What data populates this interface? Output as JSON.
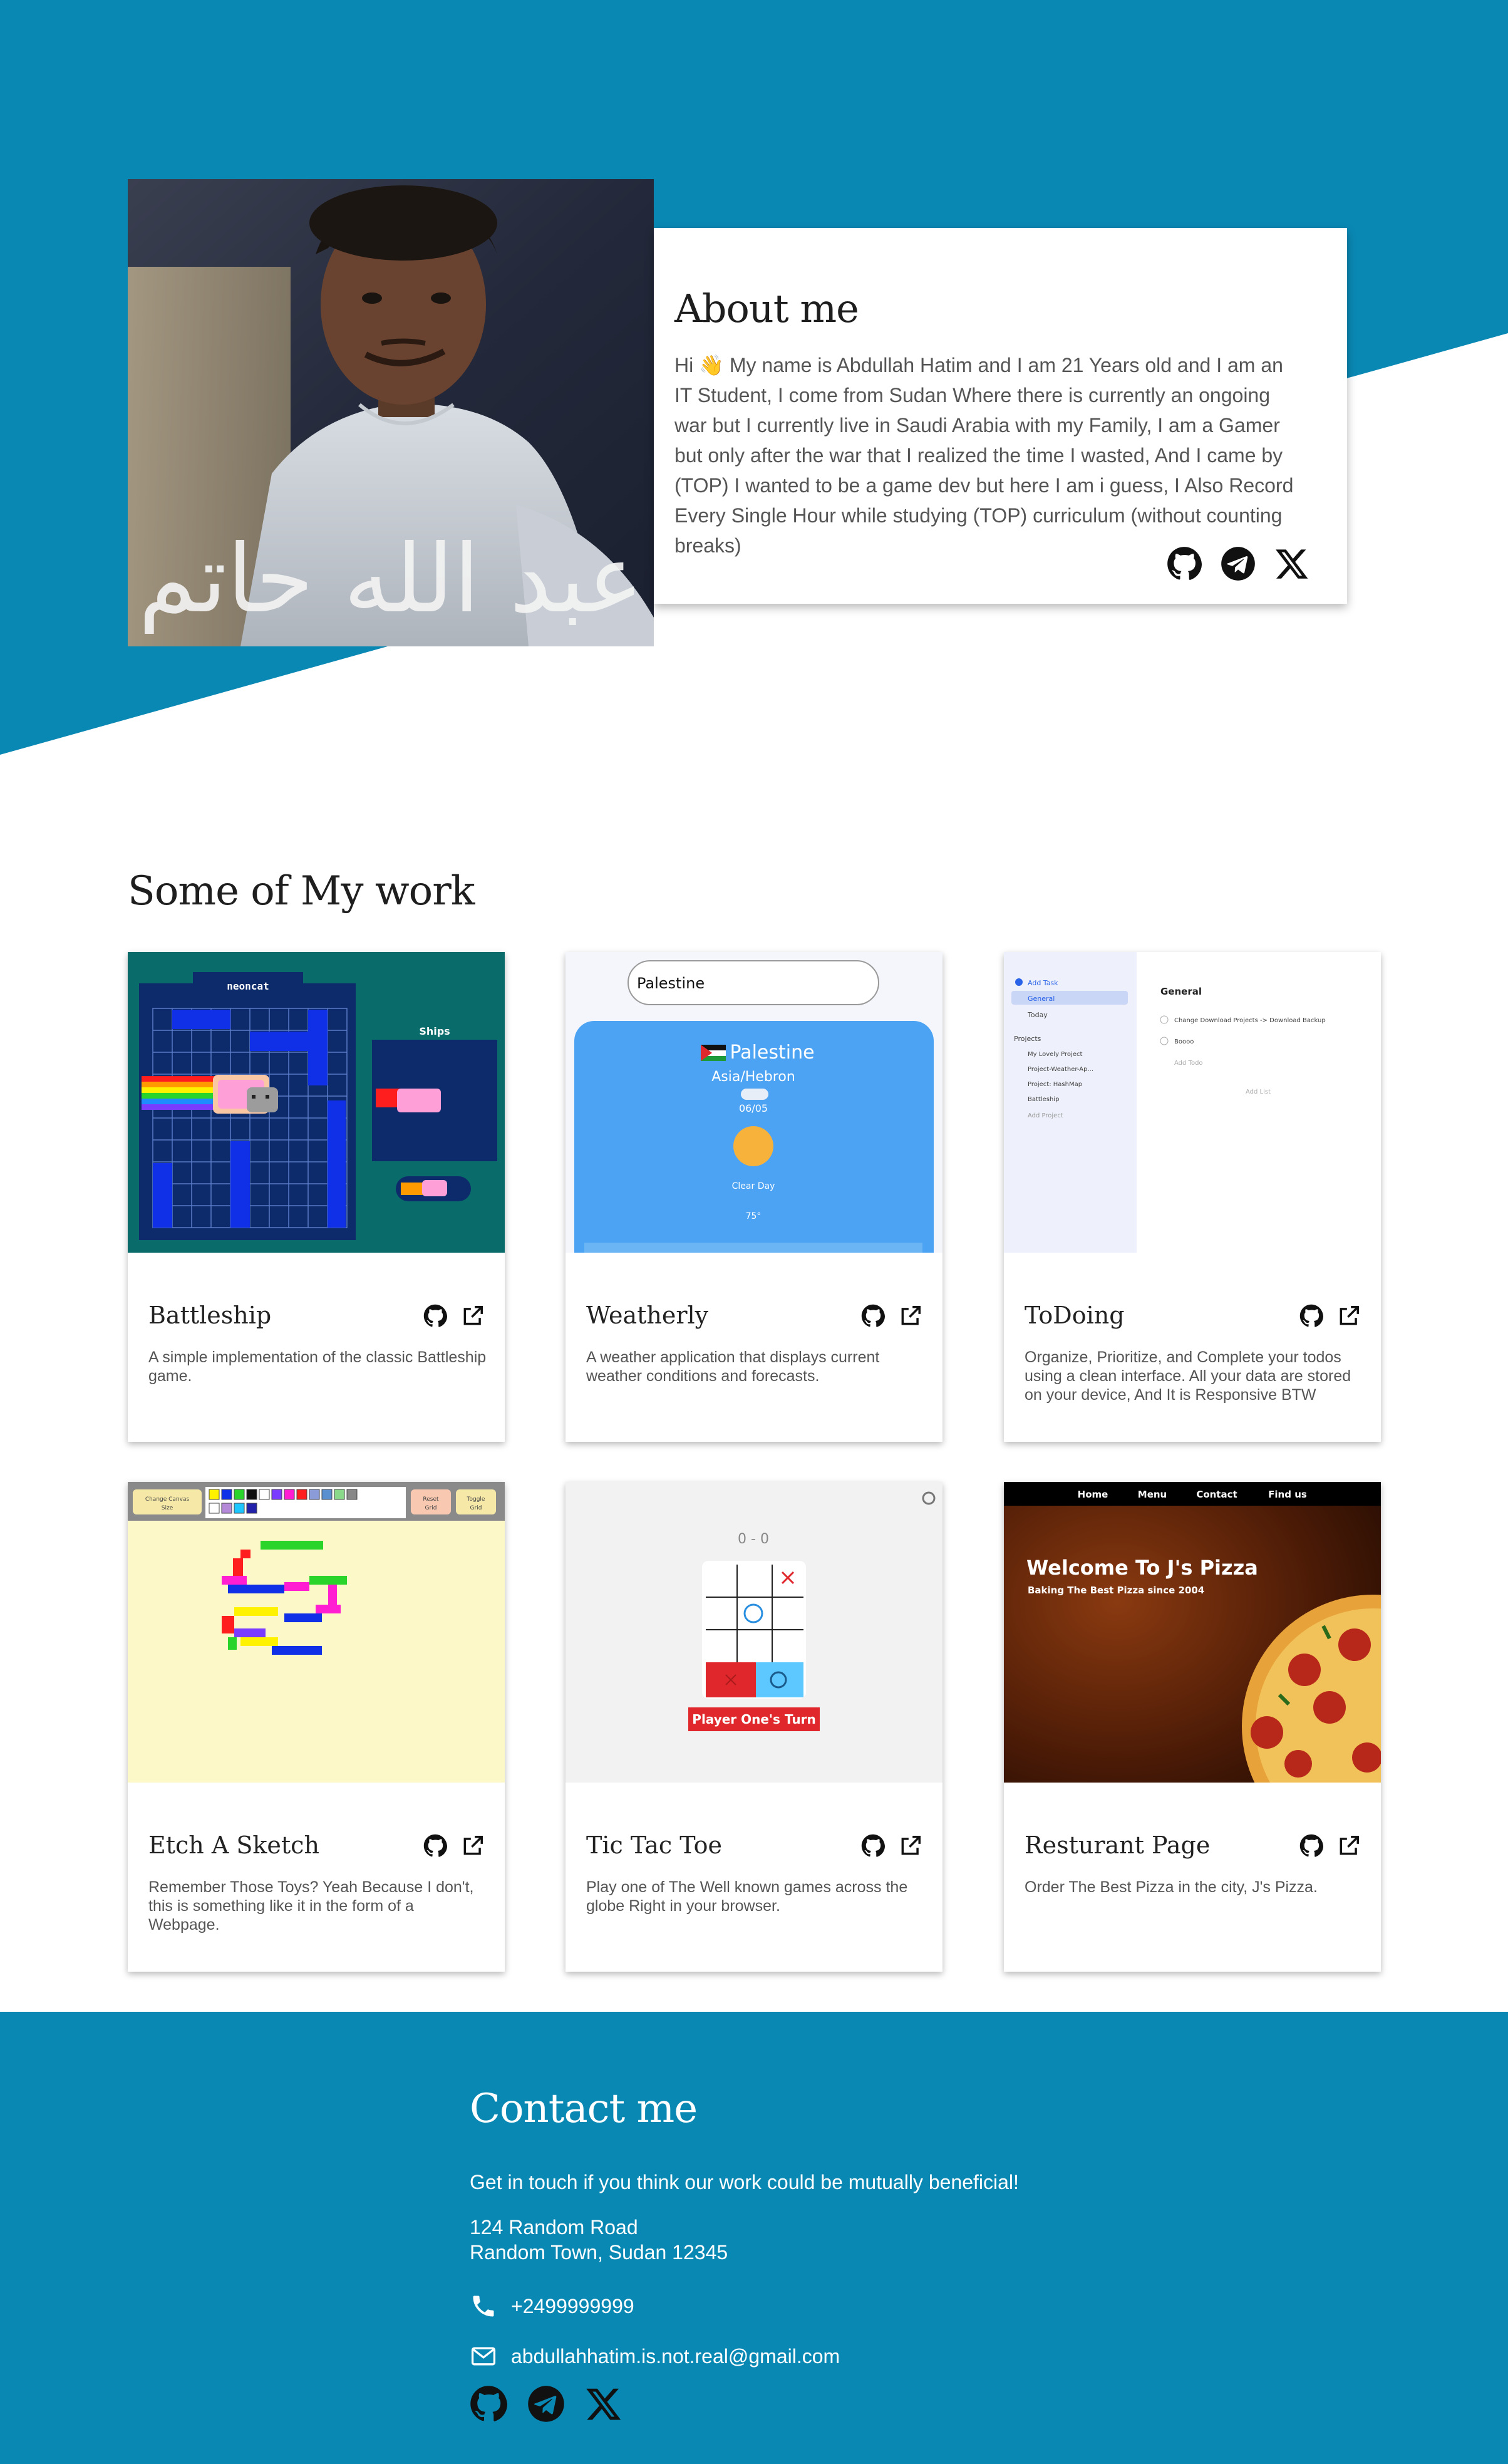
{
  "colors": {
    "primary": "#0a88b4",
    "card_bg": "#ffffff",
    "text_dark": "#1e1e1e",
    "text_muted": "#555555"
  },
  "about": {
    "title": "About me",
    "text": "Hi 👋 My name is Abdullah Hatim and I am 21 Years old and I am an IT Student, I come from Sudan Where there is currently an ongoing war but I currently live in Saudi Arabia with my Family, I am a Gamer but only after the war that I realized the time I wasted, And I came by (TOP) I wanted to be a game dev but here I am i guess, I Also Record Every Single Hour while studying (TOP) curriculum (without counting breaks)",
    "portrait_alt": "Portrait of Abdullah Hatim",
    "calligraphy": "عبد الله حاتم",
    "icons": [
      "github-icon",
      "telegram-icon",
      "x-icon"
    ]
  },
  "work": {
    "title": "Some of My work",
    "projects": [
      {
        "title": "Battleship",
        "description": "A simple implementation of the classic Battleship game.",
        "thumb": {
          "board_title": "neoncat",
          "side_title": "Ships"
        }
      },
      {
        "title": "Weatherly",
        "description": "A weather application that displays current weather conditions and forecasts.",
        "thumb": {
          "search": "Palestine",
          "city": "Palestine",
          "region": "Asia/Hebron",
          "date": "06/05",
          "condition": "Clear Day",
          "temp": "75°"
        }
      },
      {
        "title": "ToDoing",
        "description": "Organize, Prioritize, and Complete your todos using a clean interface. All your data are stored on your device, And It is Responsive BTW",
        "thumb": {
          "add_task": "Add Task",
          "general": "General",
          "today": "Today",
          "projects_label": "Projects",
          "projects": [
            "My Lovely Project",
            "Project-Weather-Ap...",
            "Project: HashMap",
            "Battleship"
          ],
          "add_project": "Add Project",
          "main_title": "General",
          "tasks": [
            "Change Download Projects -> Download Backup",
            "Boooo"
          ],
          "add_todo": "Add Todo",
          "add_list": "Add List"
        }
      },
      {
        "title": "Etch A Sketch",
        "description": "Remember Those Toys? Yeah Because I don't, this is something like it in the form of a Webpage.",
        "thumb": {
          "btn_canvas": "Change Canvas Size",
          "btn_reset": "Reset Grid",
          "btn_toggle": "Toggle Grid"
        }
      },
      {
        "title": "Tic Tac Toe",
        "description": "Play one of The Well known games across the globe Right in your browser.",
        "thumb": {
          "score": "0 - 0",
          "turn": "Player One's Turn"
        }
      },
      {
        "title": "Resturant Page",
        "description": "Order The Best Pizza in the city, J's Pizza.",
        "thumb": {
          "nav": [
            "Home",
            "Menu",
            "Contact",
            "Find us"
          ],
          "headline": "Welcome To J's Pizza",
          "sub": "Baking The Best Pizza since 2004"
        }
      }
    ]
  },
  "contact": {
    "title": "Contact me",
    "lead": "Get in touch if you think our work could be mutually beneficial!",
    "address_line1": "124 Random Road",
    "address_line2": "Random Town, Sudan 12345",
    "phone": "+2499999999",
    "email": "abdullahhatim.is.not.real@gmail.com",
    "icons": [
      "github-icon",
      "telegram-icon",
      "x-icon"
    ]
  }
}
